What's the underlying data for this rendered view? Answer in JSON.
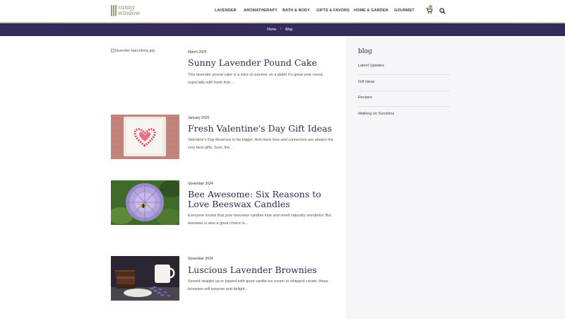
{
  "brand": {
    "line1": "sunny",
    "line2": "window"
  },
  "nav": [
    "LAVENDER",
    "AROMATHERAPY",
    "BATH & BODY",
    "GIFTS & FAVORS",
    "HOME & GARDEN",
    "GOURMET"
  ],
  "icons": {
    "cart": "cart-icon",
    "search": "search-icon"
  },
  "breadcrumb": {
    "home": "Home",
    "current": "Blog"
  },
  "sidebar": {
    "title": "blog",
    "links": [
      "Latest Updates",
      "Gift Ideas",
      "Recipes",
      "Walking on Sunshine"
    ]
  },
  "posts": [
    {
      "image_alt": "lavender-barcelona.jpg",
      "date": "March 2025",
      "title": "Sunny Lavender Pound Cake",
      "excerpt": "This lavender pound cake is a slice of summer on a plate!  It's great year round, especially with fresh fruit..."
    },
    {
      "date": "January 2025",
      "title": "Fresh Valentine's Day Gift Ideas",
      "excerpt": "Valentine's Day deserves to be bigger. And more love and connection are always the very best gifts. Sure, the..."
    },
    {
      "date": "November 2024",
      "title": "Bee Awesome: Six Reasons to Love Beeswax Candles",
      "excerpt": "Everyone knows that pure beeswax candles look and smell naturally wonderful.  But beeswax is also a great choice in..."
    },
    {
      "date": "November 2024",
      "title": "Luscious Lavender Brownies",
      "excerpt": "Served straight up or topped with good vanilla ice cream or whipped cream, these brownies will surprise and delight..."
    }
  ],
  "colors": {
    "brand_purple": "#352a5c",
    "title": "#2c2a50",
    "sidebar_bg": "#f6f6f9"
  }
}
